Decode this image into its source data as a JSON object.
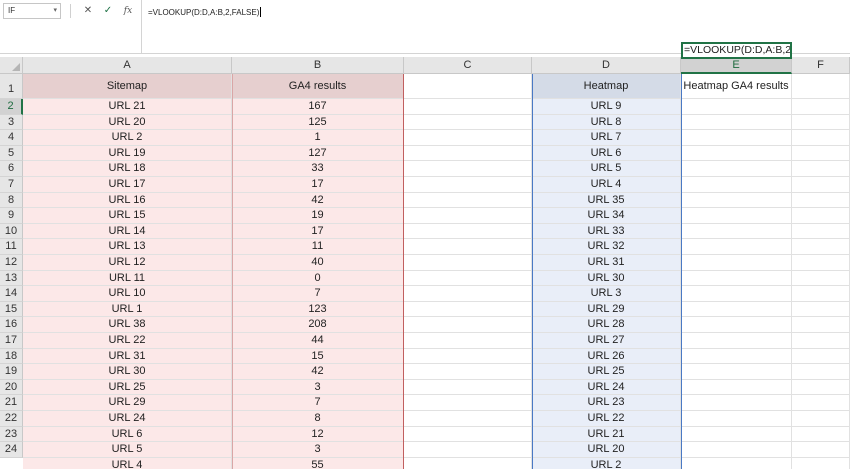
{
  "formula_bar": {
    "name_box": "IF",
    "formula": "=VLOOKUP(D:D,A:B,2,FALSE)",
    "cancel_icon": "✕",
    "enter_icon": "✓",
    "fx_label": "fx"
  },
  "columns": [
    "A",
    "B",
    "C",
    "D",
    "E",
    "F"
  ],
  "active_column": "E",
  "rows": [
    "1",
    "2",
    "3",
    "4",
    "5",
    "6",
    "7",
    "8",
    "9",
    "10",
    "11",
    "12",
    "13",
    "14",
    "15",
    "16",
    "17",
    "18",
    "19",
    "20",
    "21",
    "22",
    "23",
    "24"
  ],
  "active_row": "2",
  "headers": {
    "sitemap": "Sitemap",
    "ga4_results": "GA4 results",
    "heatmap": "Heatmap",
    "heatmap_ga4_results": "Heatmap GA4 results"
  },
  "sitemap_rows": [
    [
      "URL 21",
      "167"
    ],
    [
      "URL 20",
      "125"
    ],
    [
      "URL 2",
      "1"
    ],
    [
      "URL 19",
      "127"
    ],
    [
      "URL 18",
      "33"
    ],
    [
      "URL 17",
      "17"
    ],
    [
      "URL 16",
      "42"
    ],
    [
      "URL 15",
      "19"
    ],
    [
      "URL 14",
      "17"
    ],
    [
      "URL 13",
      "11"
    ],
    [
      "URL 12",
      "40"
    ],
    [
      "URL 11",
      "0"
    ],
    [
      "URL 10",
      "7"
    ],
    [
      "URL 1",
      "123"
    ],
    [
      "URL 38",
      "208"
    ],
    [
      "URL 22",
      "44"
    ],
    [
      "URL 31",
      "15"
    ],
    [
      "URL 30",
      "42"
    ],
    [
      "URL 25",
      "3"
    ],
    [
      "URL 29",
      "7"
    ],
    [
      "URL 24",
      "8"
    ],
    [
      "URL 6",
      "12"
    ],
    [
      "URL 5",
      "3"
    ],
    [
      "URL 4",
      "55"
    ]
  ],
  "heatmap_rows": [
    "URL 9",
    "URL 8",
    "URL 7",
    "URL 6",
    "URL 5",
    "URL 4",
    "URL 35",
    "URL 34",
    "URL 33",
    "URL 32",
    "URL 31",
    "URL 30",
    "URL 3",
    "URL 29",
    "URL 28",
    "URL 27",
    "URL 26",
    "URL 25",
    "URL 24",
    "URL 23",
    "URL 22",
    "URL 21",
    "URL 20",
    "URL 2"
  ],
  "editing_cell_text": "=VLOOKUP(D:D,A:B,2,FALSE)"
}
